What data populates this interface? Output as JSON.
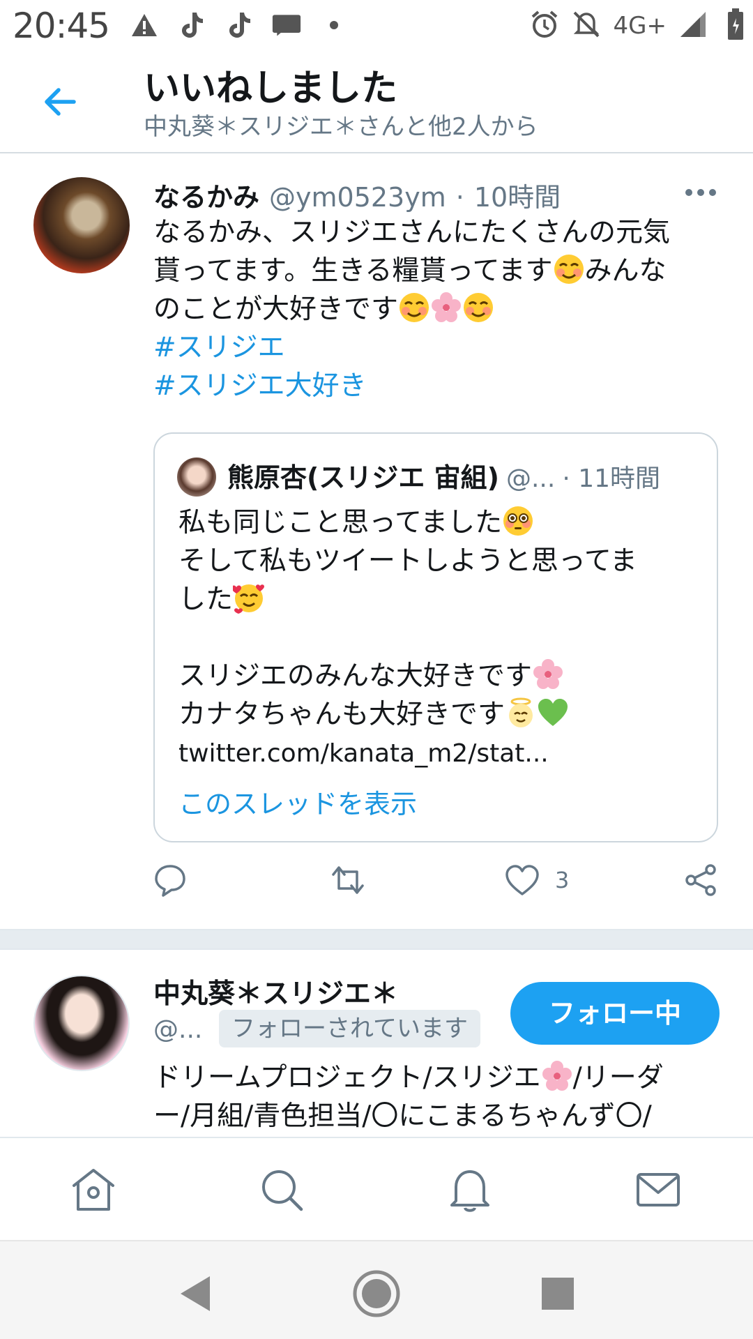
{
  "status_bar": {
    "time": "20:45",
    "network": "4G+",
    "left_icons": [
      "warning-icon",
      "tiktok-icon",
      "tiktok-icon",
      "app-755-icon",
      "dot-icon"
    ],
    "right_icons": [
      "alarm-icon",
      "mute-icon",
      "signal-icon",
      "battery-icon"
    ]
  },
  "header": {
    "title": "いいねしました",
    "subtitle": "中丸葵＊スリジエ＊さんと他2人から"
  },
  "tweet": {
    "name": "なるかみ",
    "handle": "@ym0523ym",
    "separator": "·",
    "time": "10時間",
    "text_line1": "なるかみ、スリジエさんにたくさんの元気",
    "text_line2": "貰ってます。生きる糧貰ってます",
    "text_line2b": "みんな",
    "text_line3": "のことが大好きです",
    "hashtag1": "#スリジエ",
    "hashtag2": "#スリジエ大好き",
    "quote": {
      "name": "熊原杏(スリジエ 宙組)",
      "handle": "@...",
      "time": "· 11時間",
      "line1": "私も同じこと思ってました",
      "line2": "そして私もツイートしようと思ってま",
      "line3": "した",
      "line4": "スリジエのみんな大好きです",
      "line5": "カナタちゃんも大好きです",
      "link": "twitter.com/kanata_m2/stat...",
      "thread_link": "このスレッドを表示"
    },
    "like_count": "3"
  },
  "user_card": {
    "name": "中丸葵＊スリジエ＊",
    "handle": "@...",
    "follows_you": "フォローされています",
    "follow_button": "フォロー中",
    "bio_line1": "ドリームプロジェクト/スリジエ",
    "bio_line1b": "/リーダ",
    "bio_line2": "ー/月組/青色担当/〇にこまるちゃんず〇/"
  },
  "colors": {
    "accent": "#1da1f2",
    "link": "#1b95e0",
    "secondary_text": "#657786",
    "border": "#ccd6dd"
  }
}
